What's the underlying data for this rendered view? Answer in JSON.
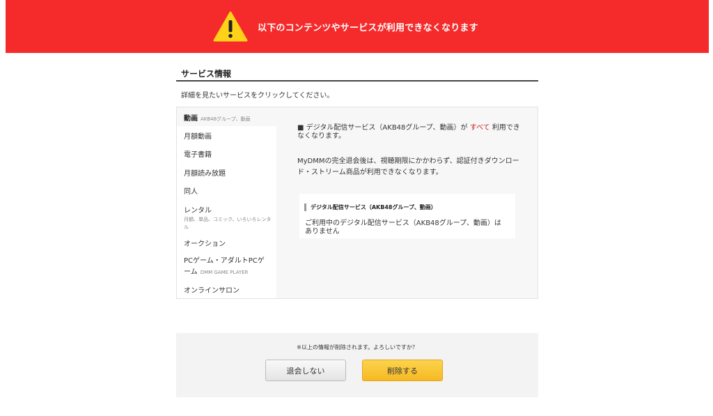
{
  "banner": {
    "icon": "warning-icon",
    "text": "以下のコンテンツやサービスが利用できなくなります",
    "color": "#f52b2b"
  },
  "section": {
    "title": "サービス情報",
    "description": "詳細を見たいサービスをクリックしてください。"
  },
  "menu": {
    "active": {
      "label": "動画",
      "sub": "AKB48グループ、動画"
    },
    "items": [
      {
        "label": "月額動画",
        "sub": ""
      },
      {
        "label": "電子書籍",
        "sub": ""
      },
      {
        "label": "月額読み放題",
        "sub": ""
      },
      {
        "label": "同人",
        "sub": ""
      },
      {
        "label": "レンタル",
        "sub": "月額、単品、コミック、いろいろレンタル"
      },
      {
        "label": "オークション",
        "sub": ""
      },
      {
        "label": "PCゲーム・アダルトPCゲーム",
        "sub": "DMM GAME PLAYER"
      },
      {
        "label": "オンラインサロン",
        "sub": ""
      }
    ]
  },
  "content": {
    "lead_prefix": "■ デジタル配信サービス（AKB48グループ、動画）が",
    "lead_emphasis": "すべて",
    "lead_suffix": "利用できなくなります。",
    "emphasis_color": "#cc2222",
    "paragraph": "MyDMMの完全退会後は、視聴期限にかかわらず、認証付きダウンロード・ストリーム商品が利用できなくなります。",
    "notice": {
      "title": "デジタル配信サービス（AKB48グループ、動画）",
      "body": "ご利用中のデジタル配信サービス（AKB48グループ、動画）はありません"
    }
  },
  "confirm": {
    "text": "※以上の情報が削除されます。よろしいですか？",
    "cancel_label": "退会しない",
    "delete_label": "削除する",
    "delete_color": "#f6b923"
  }
}
